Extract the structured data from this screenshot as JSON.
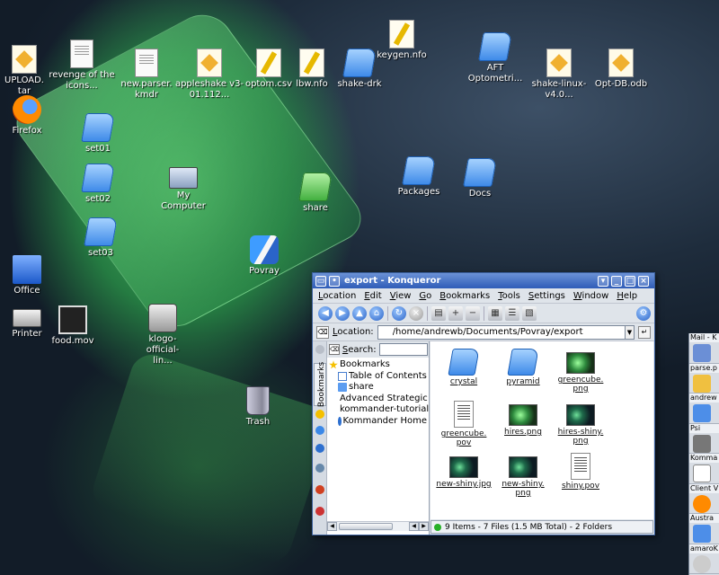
{
  "desktop": {
    "icons": [
      {
        "label": "UPLOAD.\ntar",
        "icon": "package-icon"
      },
      {
        "label": "revenge of the icons...",
        "icon": "document-icon"
      },
      {
        "label": "new.parser. kmdr",
        "icon": "document-icon"
      },
      {
        "label": "appleshake v3-01.112...",
        "icon": "package-icon"
      },
      {
        "label": "optom.csv",
        "icon": "text-file-icon"
      },
      {
        "label": "lbw.nfo",
        "icon": "text-file-icon"
      },
      {
        "label": "shake-drk",
        "icon": "folder-icon"
      },
      {
        "label": "keygen.nfo",
        "icon": "text-file-icon"
      },
      {
        "label": "AFT Optometri...",
        "icon": "folder-icon"
      },
      {
        "label": "shake-linux-v4.0...",
        "icon": "package-icon"
      },
      {
        "label": "Opt-DB.odb",
        "icon": "package-icon"
      },
      {
        "label": "Firefox",
        "icon": "firefox-icon"
      },
      {
        "label": "set01",
        "icon": "folder-icon"
      },
      {
        "label": "set02",
        "icon": "folder-icon"
      },
      {
        "label": "set03",
        "icon": "folder-icon"
      },
      {
        "label": "My Computer",
        "icon": "computer-icon"
      },
      {
        "label": "share",
        "icon": "folder-icon"
      },
      {
        "label": "Packages",
        "icon": "folder-icon"
      },
      {
        "label": "Docs",
        "icon": "folder-icon"
      },
      {
        "label": "Povray",
        "icon": "povray-icon"
      },
      {
        "label": "Office",
        "icon": "office-icon"
      },
      {
        "label": "Printer",
        "icon": "printer-icon"
      },
      {
        "label": "food.mov",
        "icon": "film-icon"
      },
      {
        "label": "klogo-official-lin...",
        "icon": "camera-icon"
      },
      {
        "label": "Trash",
        "icon": "trash-icon"
      }
    ]
  },
  "konqueror": {
    "title": "export - Konqueror",
    "menu": [
      "Location",
      "Edit",
      "View",
      "Go",
      "Bookmarks",
      "Tools",
      "Settings",
      "Window",
      "Help"
    ],
    "location_label": "Location:",
    "location_value": "/home/andrewb/Documents/Povray/export",
    "search_label": "Search:",
    "side_tab_label": "Bookmarks",
    "bookmarks": {
      "root": "Bookmarks",
      "items": [
        "Table of Contents",
        "share",
        "Advanced Strategic C",
        "kommander-tutorial -",
        "Kommander Home"
      ]
    },
    "files": [
      {
        "name": "crystal",
        "type": "folder"
      },
      {
        "name": "pyramid",
        "type": "folder"
      },
      {
        "name": "greencube.\npng",
        "type": "image"
      },
      {
        "name": "greencube.\npov",
        "type": "text"
      },
      {
        "name": "hires.png",
        "type": "image"
      },
      {
        "name": "hires-shiny.\npng",
        "type": "image-dark"
      },
      {
        "name": "new-shiny.jpg",
        "type": "image-dark"
      },
      {
        "name": "new-shiny.\npng",
        "type": "image-dark"
      },
      {
        "name": "shiny.pov",
        "type": "text"
      }
    ],
    "status": "9 Items - 7 Files (1.5 MB Total) - 2 Folders"
  },
  "taskbar": {
    "tasks": [
      "Mail - K",
      "parse.p",
      "andrew",
      "Psi",
      "Komma",
      "Client V",
      "Austra",
      "amaroK"
    ]
  }
}
